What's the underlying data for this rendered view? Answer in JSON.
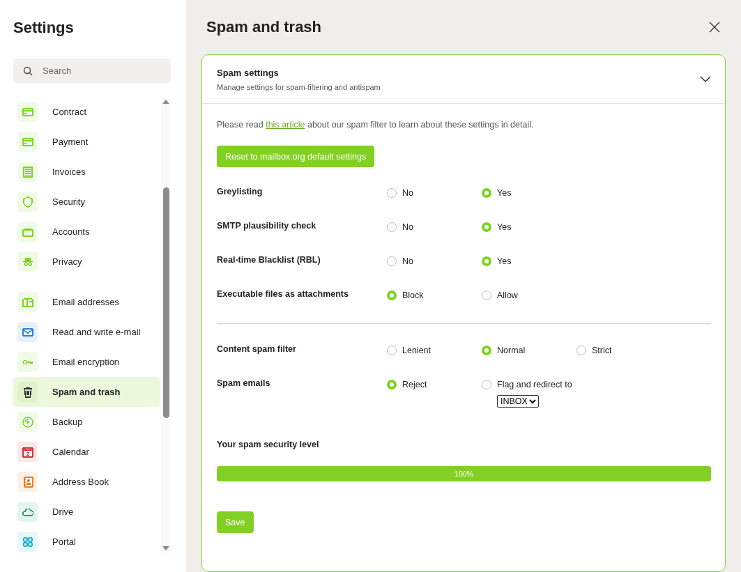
{
  "sidebar": {
    "title": "Settings",
    "search": {
      "placeholder": "Search"
    },
    "groups": [
      {
        "items": [
          {
            "label": "Contract",
            "kind": "card",
            "color": "#7ed321",
            "selected": false
          },
          {
            "label": "Payment",
            "kind": "card",
            "color": "#7ed321",
            "selected": false
          },
          {
            "label": "Invoices",
            "kind": "invoice",
            "color": "#7ed321",
            "selected": false
          },
          {
            "label": "Security",
            "kind": "shield",
            "color": "#7ed321",
            "selected": false
          },
          {
            "label": "Accounts",
            "kind": "accounts",
            "color": "#7ed321",
            "selected": false
          },
          {
            "label": "Privacy",
            "kind": "spy",
            "color": "#7ed321",
            "selected": false
          }
        ]
      },
      {
        "items": [
          {
            "label": "Email addresses",
            "kind": "mailbox",
            "color": "#7ed321",
            "selected": false
          },
          {
            "label": "Read and write e-mail",
            "kind": "envelope",
            "color": "#2f80d8",
            "selected": false
          },
          {
            "label": "Email encryption",
            "kind": "key",
            "color": "#7ed321",
            "selected": false
          },
          {
            "label": "Spam and trash",
            "kind": "trash",
            "color": "#333333",
            "selected": true
          },
          {
            "label": "Backup",
            "kind": "disc",
            "color": "#7ed321",
            "selected": false
          },
          {
            "label": "Calendar",
            "kind": "calendar",
            "color": "#d0343a",
            "selected": false
          },
          {
            "label": "Address Book",
            "kind": "contacts",
            "color": "#f07f1e",
            "selected": false
          },
          {
            "label": "Drive",
            "kind": "cloud",
            "color": "#1f9e7a",
            "selected": false
          },
          {
            "label": "Portal",
            "kind": "grid",
            "color": "#22b3d6",
            "selected": false
          }
        ]
      }
    ]
  },
  "page": {
    "title": "Spam and trash",
    "panel": {
      "title": "Spam settings",
      "subtitle": "Manage settings for spam-filtering and antispam",
      "expanded": true,
      "intro": {
        "before": "Please read ",
        "link": "this article",
        "after": " about our spam filter to learn about these settings in detail."
      },
      "reset_button": "Reset to mailbox.org default settings",
      "sections": [
        {
          "settings": [
            {
              "label": "Greylisting",
              "options": [
                {
                  "label": "No",
                  "selected": false
                },
                {
                  "label": "Yes",
                  "selected": true
                }
              ]
            },
            {
              "label": "SMTP plausibility check",
              "options": [
                {
                  "label": "No",
                  "selected": false
                },
                {
                  "label": "Yes",
                  "selected": true
                }
              ]
            },
            {
              "label": "Real-time Blacklist (RBL)",
              "options": [
                {
                  "label": "No",
                  "selected": false
                },
                {
                  "label": "Yes",
                  "selected": true
                }
              ]
            },
            {
              "label": "Executable files as attachments",
              "options": [
                {
                  "label": "Block",
                  "selected": true
                },
                {
                  "label": "Allow",
                  "selected": false
                }
              ]
            }
          ]
        },
        {
          "settings": [
            {
              "label": "Content spam filter",
              "options": [
                {
                  "label": "Lenient",
                  "selected": false
                },
                {
                  "label": "Normal",
                  "selected": true
                },
                {
                  "label": "Strict",
                  "selected": false
                }
              ]
            },
            {
              "label": "Spam emails",
              "options": [
                {
                  "label": "Reject",
                  "selected": true
                },
                {
                  "label": "Flag and redirect to",
                  "selected": false,
                  "select": "INBOX"
                }
              ]
            }
          ]
        }
      ],
      "security_level": {
        "label": "Your spam security level",
        "level": 1,
        "reading": "100%"
      },
      "save_button": "Save"
    }
  }
}
